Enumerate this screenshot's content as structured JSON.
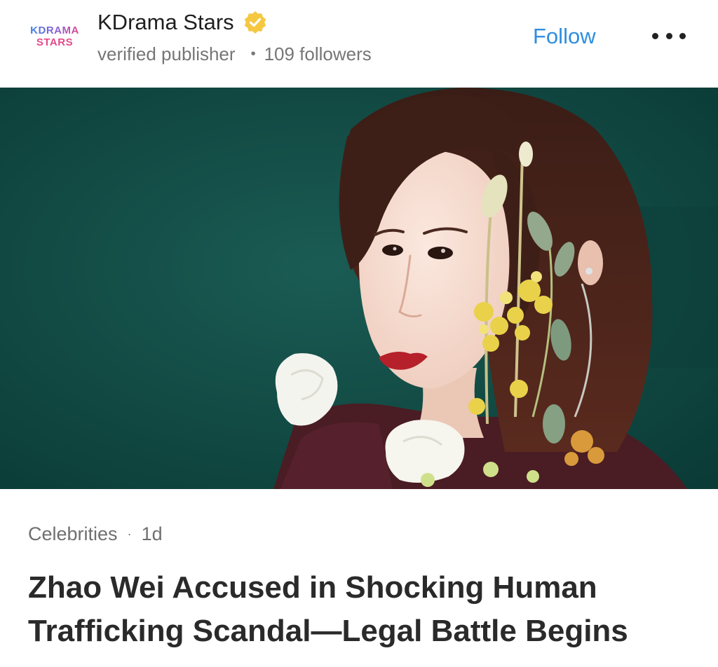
{
  "publisher": {
    "logo_line1": "KDRAMA",
    "logo_line2": "STARS",
    "name": "KDrama Stars",
    "verified_badge_icon": "verified-check-badge-icon",
    "subtitle": "verified publisher",
    "followers": "109 followers",
    "follow_label": "Follow",
    "more_icon": "more-horizontal-icon"
  },
  "hero": {
    "image_subject": "woman-with-flowers-photo"
  },
  "article": {
    "category": "Celebrities",
    "age": "1d",
    "title": "Zhao Wei Accused in Shocking Human Trafficking Scandal—Legal Battle Begins"
  },
  "colors": {
    "accent": "#2f8ee0",
    "badge": "#f5c842",
    "hero_background": "#104741"
  }
}
